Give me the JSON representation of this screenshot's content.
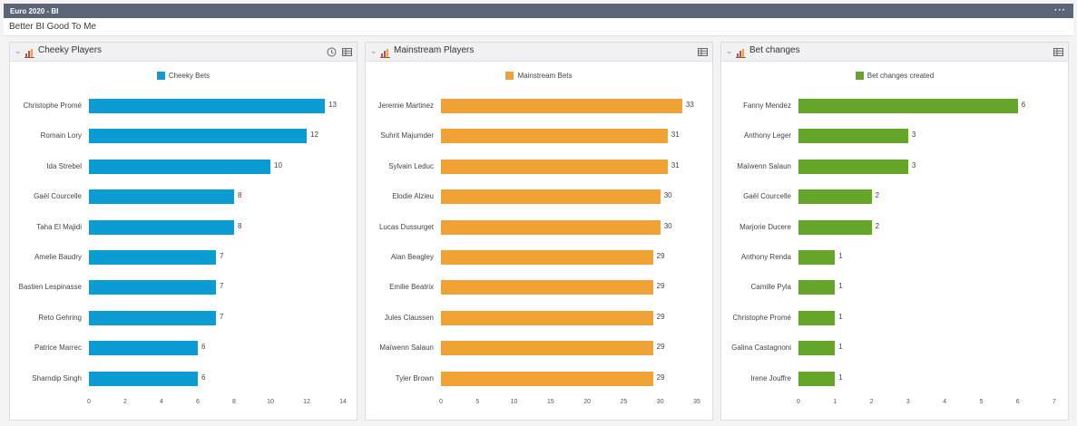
{
  "app": {
    "title": "Euro 2020 - BI",
    "subtitle": "Better BI Good To Me"
  },
  "panels": [
    {
      "title": "Cheeky Players",
      "color": "#0b9cd3",
      "legend": "Cheeky Bets",
      "has_clock": true,
      "chart_data": {
        "type": "bar",
        "orientation": "horizontal",
        "categories": [
          "Christophe Promé",
          "Romain Lory",
          "Ida Strebel",
          "Gaël Courcelle",
          "Taha El Majidi",
          "Amelie Baudry",
          "Bastien Lespinasse",
          "Reto Gehring",
          "Patrice Marrec",
          "Sharndip Singh"
        ],
        "series": [
          {
            "name": "Cheeky Bets",
            "values": [
              13,
              12,
              10,
              8,
              8,
              7,
              7,
              7,
              6,
              6
            ]
          }
        ],
        "xlim": [
          0,
          14
        ],
        "ticks": [
          0,
          2,
          4,
          6,
          8,
          10,
          12,
          14
        ],
        "legend_position": "top-center"
      }
    },
    {
      "title": "Mainstream Players",
      "color": "#f0a234",
      "legend": "Mainstream Bets",
      "has_clock": false,
      "chart_data": {
        "type": "bar",
        "orientation": "horizontal",
        "categories": [
          "Jeremie Martinez",
          "Suhrit Majumder",
          "Sylvain Leduc",
          "Elodie Alzieu",
          "Lucas Dussurget",
          "Alan Beagley",
          "Emilie Beatrix",
          "Jules Claussen",
          "Maïwenn Salaun",
          "Tyler Brown"
        ],
        "series": [
          {
            "name": "Mainstream Bets",
            "values": [
              33,
              31,
              31,
              30,
              30,
              29,
              29,
              29,
              29,
              29
            ]
          }
        ],
        "xlim": [
          0,
          35
        ],
        "ticks": [
          0,
          5,
          10,
          15,
          20,
          25,
          30,
          35
        ],
        "legend_position": "top-center"
      }
    },
    {
      "title": "Bet changes",
      "color": "#64a52a",
      "legend": "Bet changes created",
      "has_clock": false,
      "chart_data": {
        "type": "bar",
        "orientation": "horizontal",
        "categories": [
          "Fanny Mendez",
          "Anthony Leger",
          "Maïwenn Salaun",
          "Gaël Courcelle",
          "Marjorie Ducere",
          "Anthony Renda",
          "Camille Pyla",
          "Christophe Promé",
          "Galina Castagnoni",
          "Irene Jouffre"
        ],
        "series": [
          {
            "name": "Bet changes created",
            "values": [
              6,
              3,
              3,
              2,
              2,
              1,
              1,
              1,
              1,
              1
            ]
          }
        ],
        "xlim": [
          0,
          7
        ],
        "ticks": [
          0,
          1,
          2,
          3,
          4,
          5,
          6,
          7
        ],
        "legend_position": "top-center"
      }
    }
  ]
}
